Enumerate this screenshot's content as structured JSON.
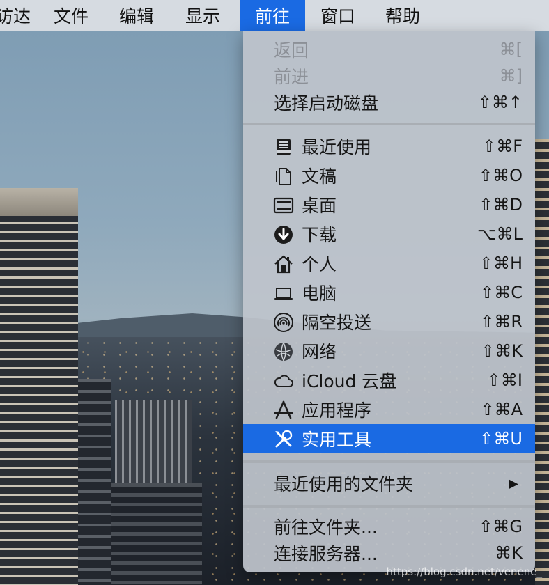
{
  "menubar": {
    "items": [
      {
        "label": "访达"
      },
      {
        "label": "文件"
      },
      {
        "label": "编辑"
      },
      {
        "label": "显示"
      },
      {
        "label": "前往"
      },
      {
        "label": "窗口"
      },
      {
        "label": "帮助"
      }
    ]
  },
  "go_menu": {
    "back": {
      "label": "返回",
      "shortcut": "⌘["
    },
    "forward": {
      "label": "前进",
      "shortcut": "⌘]"
    },
    "startup_disk": {
      "label": "选择启动磁盘",
      "shortcut": "⇧⌘↑"
    },
    "locations": [
      {
        "label": "最近使用",
        "shortcut": "⇧⌘F",
        "icon": "recents-icon"
      },
      {
        "label": "文稿",
        "shortcut": "⇧⌘O",
        "icon": "document-icon"
      },
      {
        "label": "桌面",
        "shortcut": "⇧⌘D",
        "icon": "desktop-icon"
      },
      {
        "label": "下载",
        "shortcut": "⌥⌘L",
        "icon": "download-icon"
      },
      {
        "label": "个人",
        "shortcut": "⇧⌘H",
        "icon": "home-icon"
      },
      {
        "label": "电脑",
        "shortcut": "⇧⌘C",
        "icon": "laptop-icon"
      },
      {
        "label": "隔空投送",
        "shortcut": "⇧⌘R",
        "icon": "airdrop-icon"
      },
      {
        "label": "网络",
        "shortcut": "⇧⌘K",
        "icon": "network-icon"
      },
      {
        "label": "iCloud 云盘",
        "shortcut": "⇧⌘I",
        "icon": "icloud-icon"
      },
      {
        "label": "应用程序",
        "shortcut": "⇧⌘A",
        "icon": "applications-icon"
      },
      {
        "label": "实用工具",
        "shortcut": "⇧⌘U",
        "icon": "utilities-icon"
      }
    ],
    "recent_folders": {
      "label": "最近使用的文件夹",
      "arrow": "▶"
    },
    "go_to_folder": {
      "label": "前往文件夹...",
      "shortcut": "⇧⌘G"
    },
    "connect_server": {
      "label": "连接服务器...",
      "shortcut": "⌘K"
    }
  },
  "watermark": "https://blog.csdn.net/venene_"
}
